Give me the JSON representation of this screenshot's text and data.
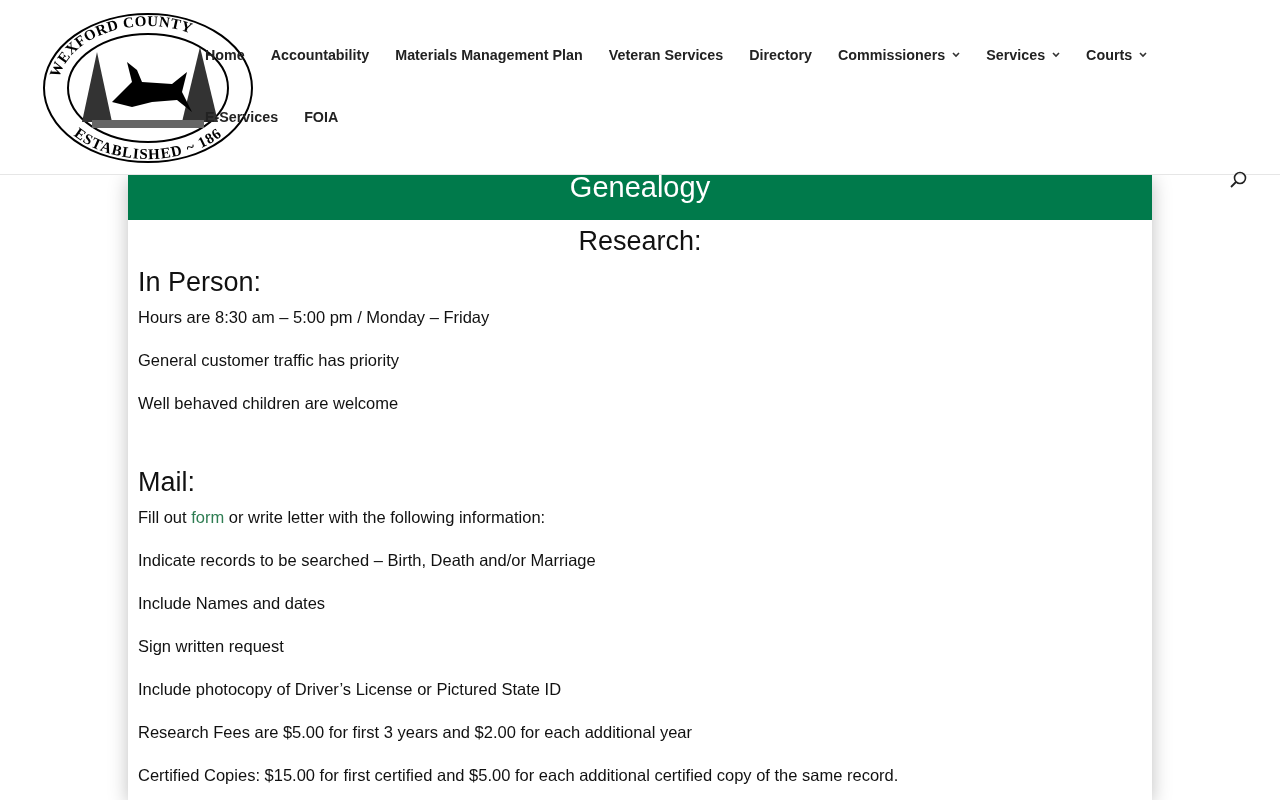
{
  "logo": {
    "top_text": "WEXFORD COUNTY",
    "bottom_text": "ESTABLISHED ~ 186"
  },
  "nav": {
    "rows": [
      [
        {
          "label": "Home",
          "dropdown": false
        },
        {
          "label": "Accountability",
          "dropdown": false
        },
        {
          "label": "Materials Management Plan",
          "dropdown": false
        },
        {
          "label": "Veteran Services",
          "dropdown": false
        },
        {
          "label": "Directory",
          "dropdown": false
        },
        {
          "label": "Commissioners",
          "dropdown": true
        },
        {
          "label": "Services",
          "dropdown": true
        },
        {
          "label": "Courts",
          "dropdown": true
        }
      ],
      [
        {
          "label": "E-Services",
          "dropdown": false
        },
        {
          "label": "FOIA",
          "dropdown": false
        }
      ]
    ]
  },
  "banner": {
    "title": "Genealogy"
  },
  "heading": "Research:",
  "sections": [
    {
      "title": "In Person:",
      "paragraphs": [
        "Hours are 8:30 am – 5:00 pm / Monday – Friday",
        "General customer traffic has priority",
        "Well behaved children are welcome"
      ]
    },
    {
      "title": "Mail:",
      "paragraphs": [
        {
          "before": "Fill out ",
          "link": "form",
          "after": " or write letter with the following information:"
        },
        "Indicate records to be searched – Birth, Death and/or Marriage",
        "Include Names and dates",
        "Sign written request",
        "Include photocopy of Driver’s License or Pictured State ID",
        "Research Fees are $5.00 for first 3 years and $2.00 for each additional year",
        "Certified Copies: $15.00 for first certified and $5.00 for each additional certified copy of the same record."
      ]
    }
  ]
}
